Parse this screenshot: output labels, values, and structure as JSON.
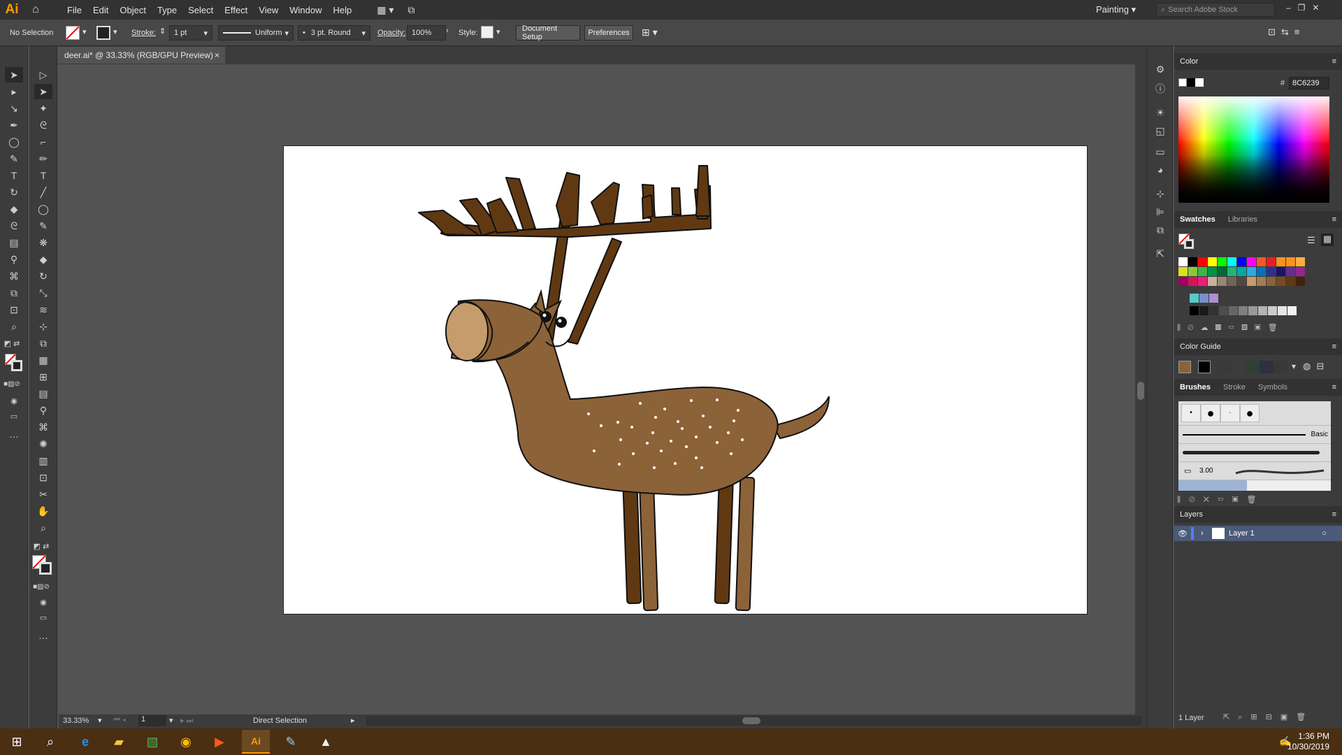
{
  "app": {
    "logo": "Ai"
  },
  "menu": {
    "items": [
      "File",
      "Edit",
      "Object",
      "Type",
      "Select",
      "Effect",
      "View",
      "Window",
      "Help"
    ]
  },
  "workspace": {
    "label": "Painting",
    "search_placeholder": "Search Adobe Stock"
  },
  "control_bar": {
    "selection": "No Selection",
    "stroke_label": "Stroke:",
    "stroke_value": "1 pt",
    "profile": "Uniform",
    "brush": "3 pt. Round",
    "opacity_label": "Opacity:",
    "opacity_value": "100%",
    "style_label": "Style:",
    "document_setup": "Document Setup",
    "preferences": "Preferences"
  },
  "document": {
    "tab_title": "deer.ai* @ 33.33% (RGB/GPU Preview)",
    "close": "×"
  },
  "status": {
    "zoom": "33.33%",
    "artboard": "1",
    "tool": "Direct Selection"
  },
  "panels": {
    "color": {
      "title": "Color",
      "hex_label": "#",
      "hex": "8C6239"
    },
    "swatches": {
      "tabs": [
        "Swatches",
        "Libraries"
      ]
    },
    "color_guide": {
      "title": "Color Guide"
    },
    "brushes": {
      "tabs": [
        "Brushes",
        "Stroke",
        "Symbols"
      ],
      "basic_label": "Basic",
      "size_label": "3.00"
    },
    "layers": {
      "title": "Layers",
      "layer_name": "Layer 1",
      "count": "1 Layer"
    }
  },
  "taskbar": {
    "time": "1:36 PM",
    "date": "10/30/2019"
  },
  "colors": {
    "accent": "#ff9a00",
    "deer_body": "#8C6239",
    "antler": "#603913",
    "snout": "#C69C6D",
    "taskbar": "#4a2f12"
  },
  "swatch_rows": [
    [
      "#ffffff",
      "#000000",
      "#ff0000",
      "#ffff00",
      "#00ff00",
      "#00ffff",
      "#0000ff",
      "#ff00ff",
      "#f15a24",
      "#ed1c24",
      "#f7931e",
      "#f7931e",
      "#fbb03b"
    ],
    [
      "#d9e021",
      "#8cc63f",
      "#39b54a",
      "#009245",
      "#006837",
      "#22b573",
      "#00a99d",
      "#29abe2",
      "#0071bc",
      "#2e3192",
      "#1b1464",
      "#662d91",
      "#93278f"
    ],
    [
      "#9e005d",
      "#d4145a",
      "#ed1e79",
      "#c7b299",
      "#998675",
      "#736357",
      "#534741",
      "#c69c6d",
      "#a67c52",
      "#8c6239",
      "#754c24",
      "#603813",
      "#42210b"
    ]
  ],
  "swatch_row_extra": [
    "#5ac8c8",
    "#7a8fc8",
    "#b08fd0"
  ],
  "swatch_greys": [
    "#000000",
    "#1a1a1a",
    "#333333",
    "#4d4d4d",
    "#666666",
    "#808080",
    "#999999",
    "#b3b3b3",
    "#cccccc",
    "#e6e6e6",
    "#f2f2f2"
  ]
}
